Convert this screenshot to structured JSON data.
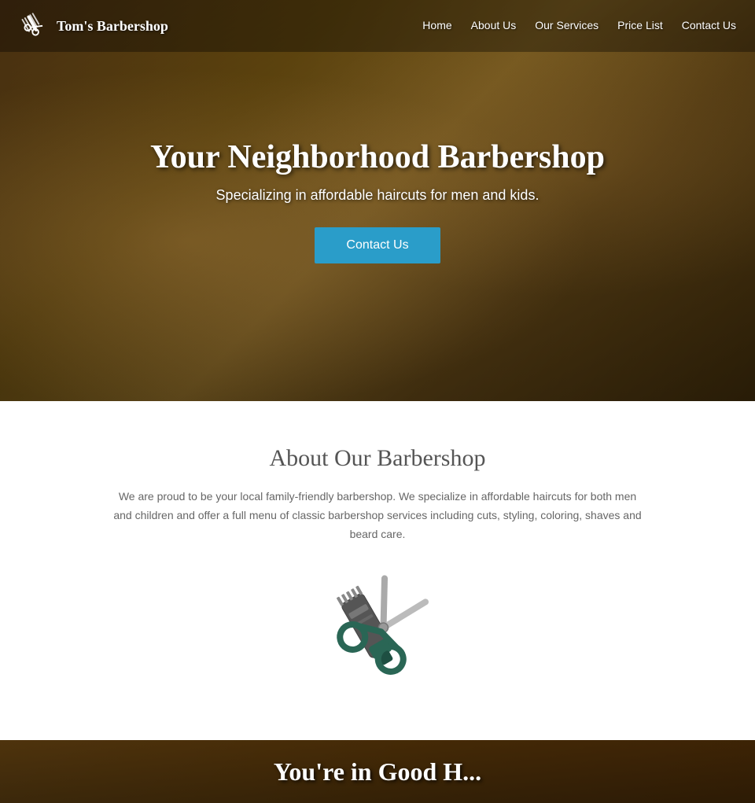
{
  "navbar": {
    "brand_name": "Tom's Barbershop",
    "links": [
      {
        "label": "Home",
        "href": "#"
      },
      {
        "label": "About Us",
        "href": "#"
      },
      {
        "label": "Our Services",
        "href": "#"
      },
      {
        "label": "Price List",
        "href": "#"
      },
      {
        "label": "Contact Us",
        "href": "#"
      }
    ]
  },
  "hero": {
    "title": "Your Neighborhood Barbershop",
    "subtitle": "Specializing in affordable haircuts for men and kids.",
    "cta_label": "Contact Us"
  },
  "about": {
    "title": "About Our Barbershop",
    "text": "We are proud to be your local family-friendly barbershop. We specialize in affordable haircuts for both men and children and offer a full menu of classic barbershop services including cuts, styling, coloring, shaves and beard care."
  },
  "bottom_teaser": {
    "text": "You're in Good H..."
  }
}
